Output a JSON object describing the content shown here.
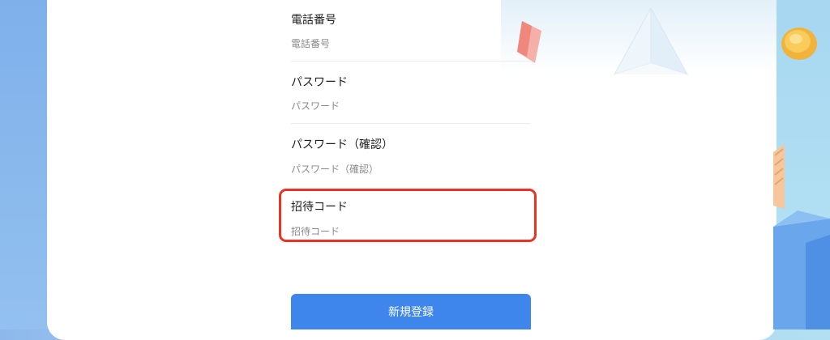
{
  "fields": [
    {
      "label": "電話番号",
      "placeholder": "電話番号"
    },
    {
      "label": "パスワード",
      "placeholder": "パスワード"
    },
    {
      "label": "パスワード（確認）",
      "placeholder": "パスワード（確認）"
    },
    {
      "label": "招待コード",
      "placeholder": "招待コード"
    }
  ],
  "submit_label": "新規登録",
  "colors": {
    "accent": "#3f86ec",
    "highlight": "#ea3323",
    "background": "#a6cdf1"
  },
  "decorations": [
    "pyramid-decoration",
    "red-ribbon-decoration",
    "gold-coin-icon",
    "striped-shape-decoration",
    "blue-block-decoration"
  ]
}
